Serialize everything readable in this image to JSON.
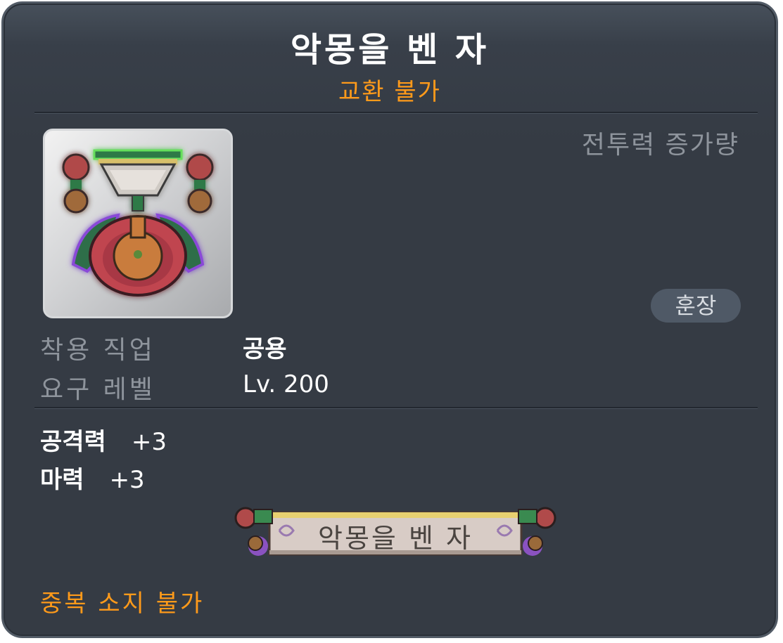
{
  "item": {
    "name": "악몽을 벤 자",
    "trade_status": "교환 불가",
    "icon": "nightmare-medal-icon"
  },
  "stats_panel": {
    "combat_power_label": "전투력 증가량",
    "category_badge": "훈장"
  },
  "requirements": {
    "job_label": "착용 직업",
    "job_value": "공용",
    "level_label": "요구 레벨",
    "level_value": "Lv. 200"
  },
  "bonuses": [
    {
      "label": "공격력",
      "value": "+3"
    },
    {
      "label": "마력",
      "value": "+3"
    }
  ],
  "medal_banner": {
    "text": "악몽을 벤 자"
  },
  "notice": "중복 소지 불가",
  "colors": {
    "background": "#353b44",
    "warning": "#ff9a1a",
    "muted_label": "#8e949c",
    "badge": "#4f5966"
  }
}
